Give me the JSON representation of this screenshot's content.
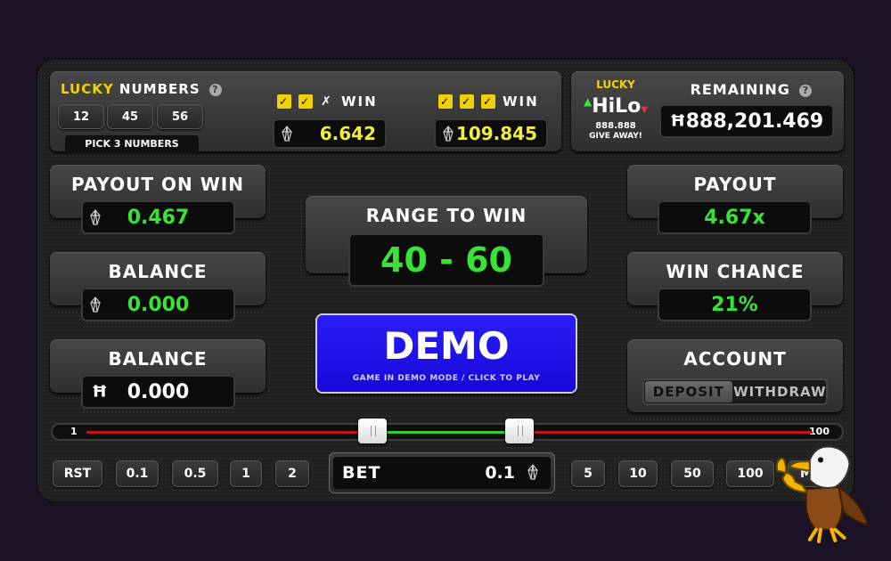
{
  "lucky_numbers": {
    "title_lucky": "LUCKY",
    "title_rest": " NUMBERS",
    "numbers": [
      "12",
      "45",
      "56"
    ],
    "pick_label": "PICK 3 NUMBERS",
    "win_label": "WIN",
    "win_two_value": "6.642",
    "win_three_value": "109.845"
  },
  "hilo_logo": {
    "lucky": "LUCKY",
    "hi": "Hi",
    "lo": "Lo",
    "amount": "888.888",
    "giveaway": "GIVE AWAY!"
  },
  "remaining": {
    "label": "REMAINING",
    "currency": "Ħ",
    "value": "888,201.469"
  },
  "payout_on_win": {
    "label": "PAYOUT ON WIN",
    "value": "0.467"
  },
  "balance_eos": {
    "label": "BALANCE",
    "value": "0.000"
  },
  "balance_hilo": {
    "label": "BALANCE",
    "currency": "Ħ",
    "value": "0.000"
  },
  "range": {
    "label": "RANGE TO WIN",
    "value": "40 - 60",
    "low": 40,
    "high": 60
  },
  "demo": {
    "label": "DEMO",
    "sublabel": "GAME IN DEMO MODE / CLICK TO PLAY"
  },
  "payout": {
    "label": "PAYOUT",
    "value": "4.67x"
  },
  "win_chance": {
    "label": "WIN CHANCE",
    "value": "21%"
  },
  "account": {
    "label": "ACCOUNT",
    "deposit": "DEPOSIT",
    "withdraw": "WITHDRAW"
  },
  "slider": {
    "min_label": "1",
    "max_label": "100",
    "min": 1,
    "max": 100,
    "low": 40,
    "high": 60
  },
  "bet": {
    "label": "BET",
    "value": "0.1",
    "left_buttons": [
      "RST",
      "0.1",
      "0.5",
      "1",
      "2"
    ],
    "right_buttons": [
      "5",
      "10",
      "50",
      "100",
      "MAX"
    ]
  },
  "colors": {
    "win_green": "#37e337",
    "jackpot_yellow": "#f2ef3c",
    "demo_blue": "#1b0ff0",
    "slider_red": "#c4141b",
    "check_yellow": "#f2d100"
  }
}
